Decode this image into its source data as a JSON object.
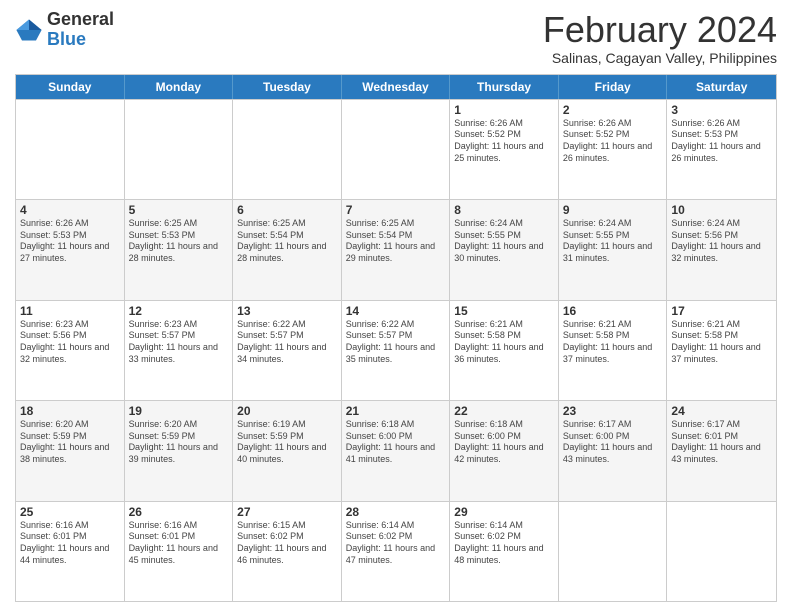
{
  "header": {
    "logo_general": "General",
    "logo_blue": "Blue",
    "month_title": "February 2024",
    "location": "Salinas, Cagayan Valley, Philippines"
  },
  "calendar": {
    "days_of_week": [
      "Sunday",
      "Monday",
      "Tuesday",
      "Wednesday",
      "Thursday",
      "Friday",
      "Saturday"
    ],
    "rows": [
      [
        {
          "day": "",
          "info": ""
        },
        {
          "day": "",
          "info": ""
        },
        {
          "day": "",
          "info": ""
        },
        {
          "day": "",
          "info": ""
        },
        {
          "day": "1",
          "info": "Sunrise: 6:26 AM\nSunset: 5:52 PM\nDaylight: 11 hours and 25 minutes."
        },
        {
          "day": "2",
          "info": "Sunrise: 6:26 AM\nSunset: 5:52 PM\nDaylight: 11 hours and 26 minutes."
        },
        {
          "day": "3",
          "info": "Sunrise: 6:26 AM\nSunset: 5:53 PM\nDaylight: 11 hours and 26 minutes."
        }
      ],
      [
        {
          "day": "4",
          "info": "Sunrise: 6:26 AM\nSunset: 5:53 PM\nDaylight: 11 hours and 27 minutes."
        },
        {
          "day": "5",
          "info": "Sunrise: 6:25 AM\nSunset: 5:53 PM\nDaylight: 11 hours and 28 minutes."
        },
        {
          "day": "6",
          "info": "Sunrise: 6:25 AM\nSunset: 5:54 PM\nDaylight: 11 hours and 28 minutes."
        },
        {
          "day": "7",
          "info": "Sunrise: 6:25 AM\nSunset: 5:54 PM\nDaylight: 11 hours and 29 minutes."
        },
        {
          "day": "8",
          "info": "Sunrise: 6:24 AM\nSunset: 5:55 PM\nDaylight: 11 hours and 30 minutes."
        },
        {
          "day": "9",
          "info": "Sunrise: 6:24 AM\nSunset: 5:55 PM\nDaylight: 11 hours and 31 minutes."
        },
        {
          "day": "10",
          "info": "Sunrise: 6:24 AM\nSunset: 5:56 PM\nDaylight: 11 hours and 32 minutes."
        }
      ],
      [
        {
          "day": "11",
          "info": "Sunrise: 6:23 AM\nSunset: 5:56 PM\nDaylight: 11 hours and 32 minutes."
        },
        {
          "day": "12",
          "info": "Sunrise: 6:23 AM\nSunset: 5:57 PM\nDaylight: 11 hours and 33 minutes."
        },
        {
          "day": "13",
          "info": "Sunrise: 6:22 AM\nSunset: 5:57 PM\nDaylight: 11 hours and 34 minutes."
        },
        {
          "day": "14",
          "info": "Sunrise: 6:22 AM\nSunset: 5:57 PM\nDaylight: 11 hours and 35 minutes."
        },
        {
          "day": "15",
          "info": "Sunrise: 6:21 AM\nSunset: 5:58 PM\nDaylight: 11 hours and 36 minutes."
        },
        {
          "day": "16",
          "info": "Sunrise: 6:21 AM\nSunset: 5:58 PM\nDaylight: 11 hours and 37 minutes."
        },
        {
          "day": "17",
          "info": "Sunrise: 6:21 AM\nSunset: 5:58 PM\nDaylight: 11 hours and 37 minutes."
        }
      ],
      [
        {
          "day": "18",
          "info": "Sunrise: 6:20 AM\nSunset: 5:59 PM\nDaylight: 11 hours and 38 minutes."
        },
        {
          "day": "19",
          "info": "Sunrise: 6:20 AM\nSunset: 5:59 PM\nDaylight: 11 hours and 39 minutes."
        },
        {
          "day": "20",
          "info": "Sunrise: 6:19 AM\nSunset: 5:59 PM\nDaylight: 11 hours and 40 minutes."
        },
        {
          "day": "21",
          "info": "Sunrise: 6:18 AM\nSunset: 6:00 PM\nDaylight: 11 hours and 41 minutes."
        },
        {
          "day": "22",
          "info": "Sunrise: 6:18 AM\nSunset: 6:00 PM\nDaylight: 11 hours and 42 minutes."
        },
        {
          "day": "23",
          "info": "Sunrise: 6:17 AM\nSunset: 6:00 PM\nDaylight: 11 hours and 43 minutes."
        },
        {
          "day": "24",
          "info": "Sunrise: 6:17 AM\nSunset: 6:01 PM\nDaylight: 11 hours and 43 minutes."
        }
      ],
      [
        {
          "day": "25",
          "info": "Sunrise: 6:16 AM\nSunset: 6:01 PM\nDaylight: 11 hours and 44 minutes."
        },
        {
          "day": "26",
          "info": "Sunrise: 6:16 AM\nSunset: 6:01 PM\nDaylight: 11 hours and 45 minutes."
        },
        {
          "day": "27",
          "info": "Sunrise: 6:15 AM\nSunset: 6:02 PM\nDaylight: 11 hours and 46 minutes."
        },
        {
          "day": "28",
          "info": "Sunrise: 6:14 AM\nSunset: 6:02 PM\nDaylight: 11 hours and 47 minutes."
        },
        {
          "day": "29",
          "info": "Sunrise: 6:14 AM\nSunset: 6:02 PM\nDaylight: 11 hours and 48 minutes."
        },
        {
          "day": "",
          "info": ""
        },
        {
          "day": "",
          "info": ""
        }
      ]
    ]
  }
}
